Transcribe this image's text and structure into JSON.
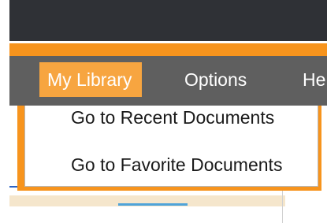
{
  "menu_bar": {
    "items": [
      {
        "label": "My Library",
        "active": true
      },
      {
        "label": "Options",
        "active": false
      },
      {
        "label": "He",
        "active": false
      }
    ]
  },
  "dropdown": {
    "items": [
      {
        "label": "Go to Recent Documents"
      },
      {
        "label": "Go to Favorite Documents"
      }
    ]
  },
  "colors": {
    "accent_orange": "#f7941d",
    "active_menu": "#f7a540",
    "menu_bar_bg": "#5f5f5f",
    "top_bar_bg": "#2f3136"
  }
}
